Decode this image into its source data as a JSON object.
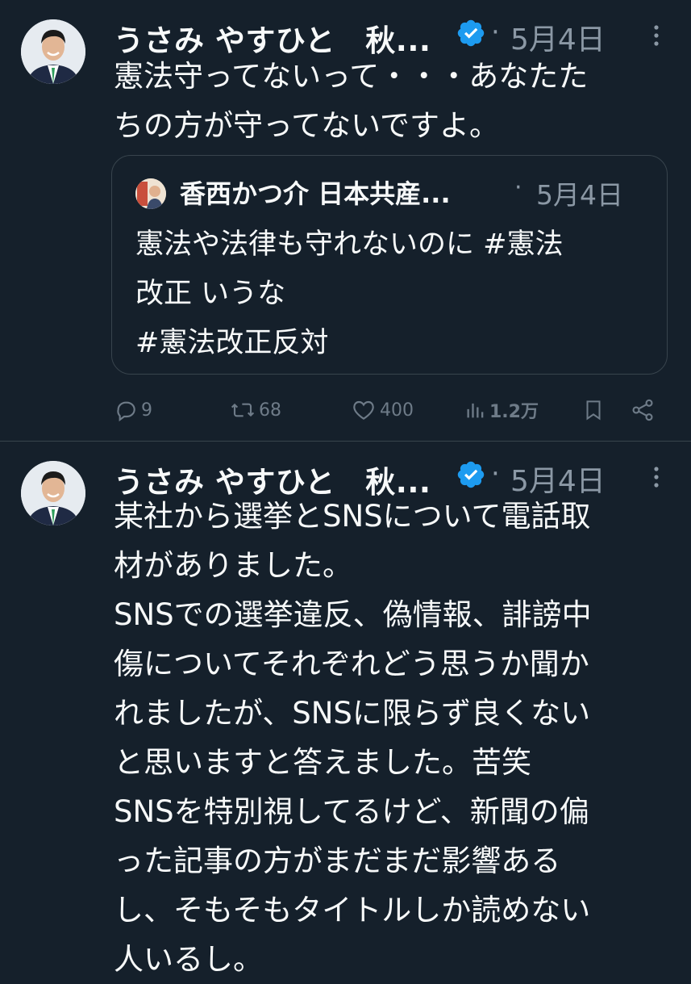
{
  "tweets": [
    {
      "author": "うさみ やすひと　秋...",
      "date": "5月4日",
      "text": "憲法守ってないって・・・あなたた\nちの方が守ってないですよ。",
      "quote": {
        "author": "香西かつ介 日本共産...",
        "date": "5月4日",
        "text": "憲法や法律も守れないのに #憲法\n改正 いうな\n#憲法改正反対"
      },
      "actions": {
        "replies": "9",
        "retweets": "68",
        "likes": "400",
        "views": "1.2万"
      }
    },
    {
      "author": "うさみ やすひと　秋...",
      "date": "5月4日",
      "text": "某社から選挙とSNSについて電話取\n材がありました。\nSNSでの選挙違反、偽情報、誹謗中\n傷についてそれぞれどう思うか聞か\nれましたが、SNSに限らず良くない\nと思いますと答えました。苦笑\nSNSを特別視してるけど、新聞の偏\nった記事の方がまだまだ影響ある\nし、そもそもタイトルしか読めない\n人いるし。"
    }
  ],
  "separator": "·",
  "colors": {
    "background": "#15202b",
    "text": "#f7f9f9",
    "muted": "#8b98a5",
    "border": "#38444d",
    "verified": "#1d9bf0"
  },
  "icons": [
    "verified-badge-icon",
    "more-options-icon",
    "reply-icon",
    "retweet-icon",
    "like-icon",
    "views-icon",
    "bookmark-icon",
    "share-icon"
  ]
}
